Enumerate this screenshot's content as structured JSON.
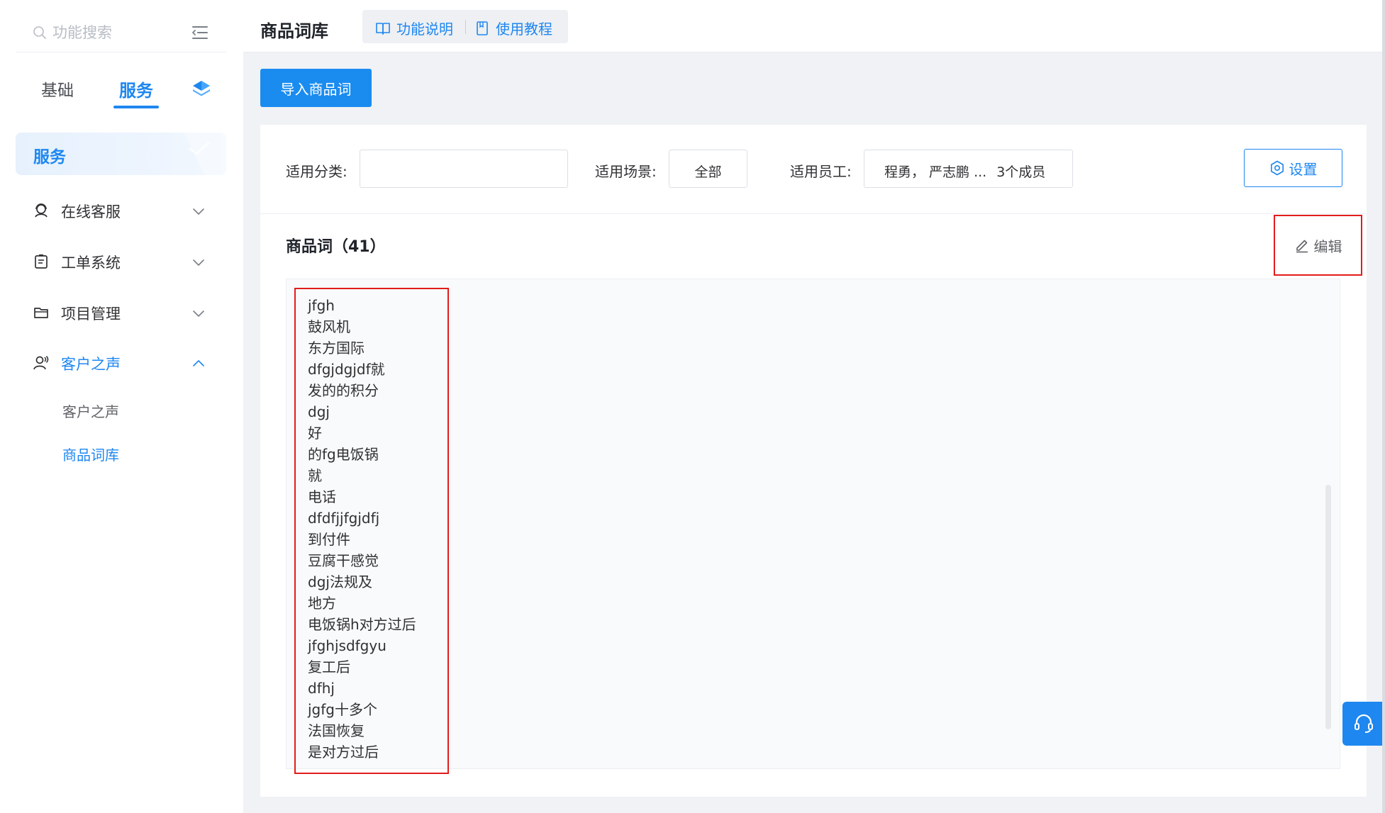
{
  "sidebar": {
    "search": {
      "placeholder": "功能搜索"
    },
    "mode_tabs": {
      "basic": "基础",
      "service": "服务"
    },
    "section_title": "服务",
    "items": [
      {
        "label": "在线客服",
        "icon": "headset-user-icon",
        "expanded": false
      },
      {
        "label": "工单系统",
        "icon": "clipboard-icon",
        "expanded": false
      },
      {
        "label": "项目管理",
        "icon": "folder-icon",
        "expanded": false
      },
      {
        "label": "客户之声",
        "icon": "user-voice-icon",
        "expanded": true
      }
    ],
    "sub_items": [
      {
        "label": "客户之声",
        "active": false
      },
      {
        "label": "商品词库",
        "active": true
      }
    ]
  },
  "header": {
    "title": "商品词库",
    "help_links": {
      "doc": "功能说明",
      "tutorial": "使用教程"
    }
  },
  "toolbar": {
    "import_label": "导入商品词"
  },
  "filters": {
    "category_label": "适用分类:",
    "category_value": "",
    "scene_label": "适用场景:",
    "scene_value": "全部",
    "staff_label": "适用员工:",
    "staff_value": "程勇， 严志鹏 ...",
    "staff_count": "3个成员",
    "settings_label": "设置"
  },
  "words": {
    "title": "商品词（41）",
    "edit_label": "编辑",
    "items": [
      "jfgh",
      "鼓风机",
      "东方国际",
      "dfgjdgjdf就",
      "发的的积分",
      "dgj",
      "好",
      "的fg电饭锅",
      "就",
      "电话",
      "dfdfjjfgjdfj",
      "到付件",
      "豆腐干感觉",
      "dgj法规及",
      "地方",
      "电饭锅h对方过后",
      "jfghjsdfgyu",
      "复工后",
      "dfhj",
      "jgfg十多个",
      "法国恢复",
      "是对方过后"
    ]
  },
  "colors": {
    "accent": "#1e87f0",
    "highlight_border": "#e21c1c",
    "page_background": "#f0f2f5"
  }
}
